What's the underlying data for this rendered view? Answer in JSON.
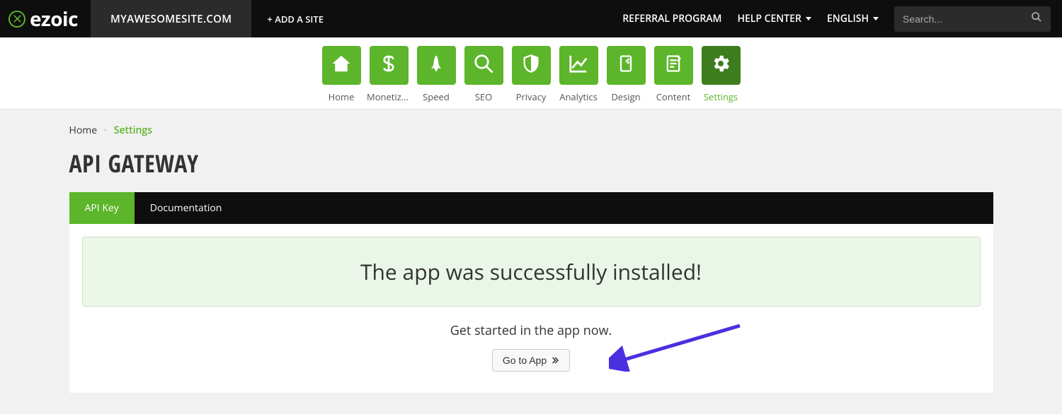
{
  "colors": {
    "brand_green": "#5cb52a",
    "brand_green_dark": "#3e7d1d",
    "topbar_bg": "#0e0e0e"
  },
  "topbar": {
    "logo_text": "ezoic",
    "site_name": "MYAWESOMESITE.COM",
    "add_site_label": "+ ADD A SITE",
    "referral_label": "REFERRAL PROGRAM",
    "help_label": "HELP CENTER",
    "language_label": "ENGLISH",
    "search_placeholder": "Search..."
  },
  "nav": {
    "items": [
      {
        "id": "home",
        "label": "Home",
        "icon": "home-icon"
      },
      {
        "id": "monetization",
        "label": "Monetiza...",
        "icon": "dollar-icon"
      },
      {
        "id": "speed",
        "label": "Speed",
        "icon": "rocket-icon"
      },
      {
        "id": "seo",
        "label": "SEO",
        "icon": "magnifier-icon"
      },
      {
        "id": "privacy",
        "label": "Privacy",
        "icon": "shield-icon"
      },
      {
        "id": "analytics",
        "label": "Analytics",
        "icon": "chart-icon"
      },
      {
        "id": "design",
        "label": "Design",
        "icon": "device-icon"
      },
      {
        "id": "content",
        "label": "Content",
        "icon": "document-icon"
      },
      {
        "id": "settings",
        "label": "Settings",
        "icon": "gear-icon"
      }
    ],
    "active_id": "settings"
  },
  "breadcrumbs": {
    "items": [
      "Home",
      "Settings"
    ]
  },
  "page": {
    "title": "API GATEWAY"
  },
  "tabs": {
    "items": [
      {
        "id": "api_key",
        "label": "API Key"
      },
      {
        "id": "documentation",
        "label": "Documentation"
      }
    ],
    "active_id": "api_key"
  },
  "panel": {
    "success_message": "The app was successfully installed!",
    "subtext": "Get started in the app now.",
    "go_button_label": "Go to App"
  }
}
